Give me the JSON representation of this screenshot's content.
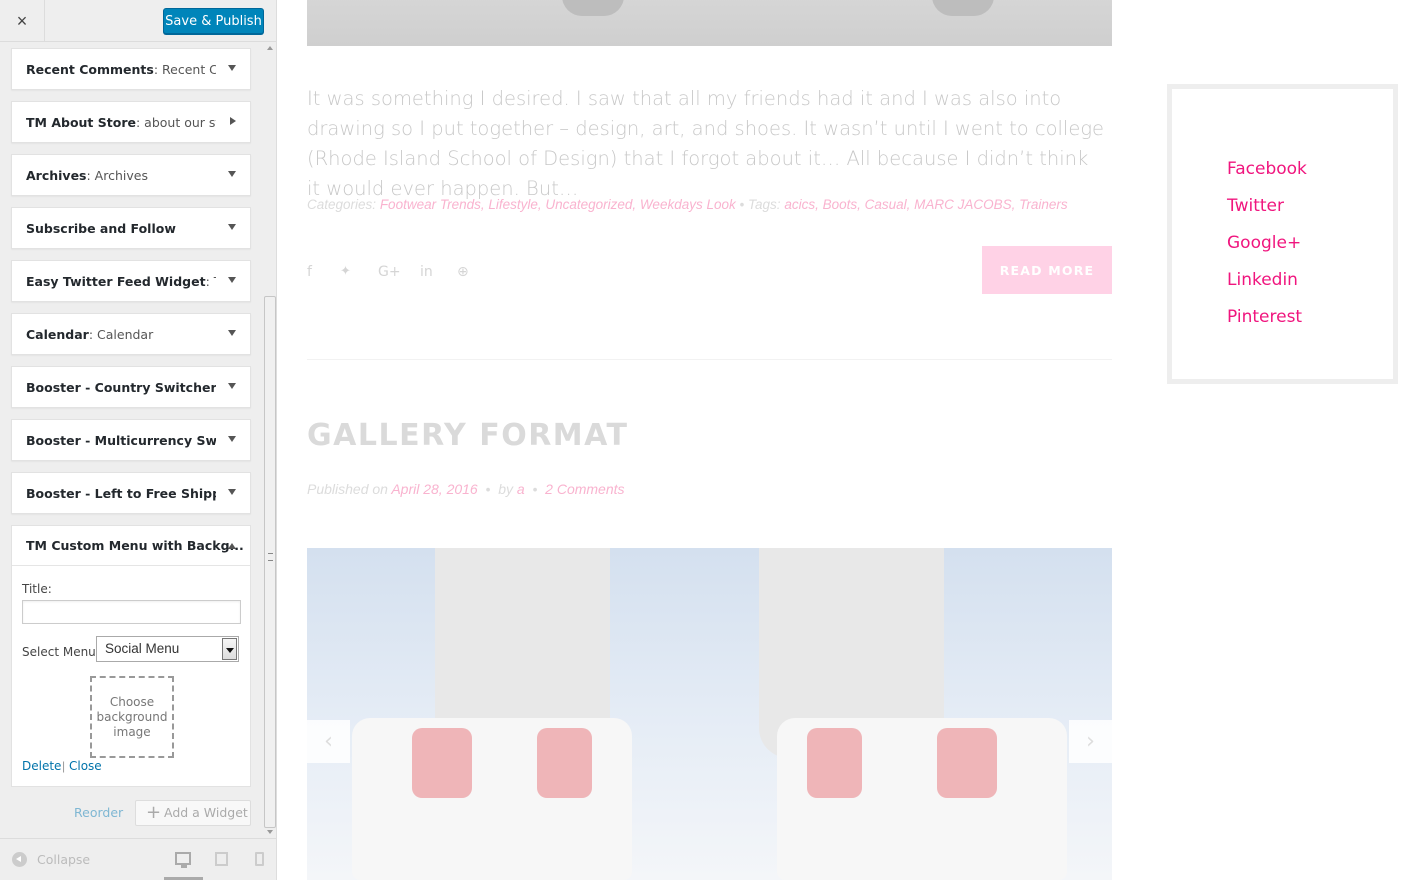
{
  "header": {
    "close_icon": "×",
    "save_label": "Save & Publish"
  },
  "widgets": [
    {
      "name": "Recent Comments",
      "subtitle": ": Recent Co...",
      "arrow": "down"
    },
    {
      "name": "TM About Store",
      "subtitle": ": about our st...",
      "arrow": "right"
    },
    {
      "name": "Archives",
      "subtitle": ": Archives",
      "arrow": "down"
    },
    {
      "name": "Subscribe and Follow",
      "subtitle": "",
      "arrow": "down"
    },
    {
      "name": "Easy Twitter Feed Widget",
      "subtitle": ": Twi...",
      "arrow": "down"
    },
    {
      "name": "Calendar",
      "subtitle": ": Calendar",
      "arrow": "down"
    },
    {
      "name": "Booster - Country Switcher",
      "subtitle": "",
      "arrow": "down"
    },
    {
      "name": "Booster - Multicurrency Switc...",
      "subtitle": "",
      "arrow": "down"
    },
    {
      "name": "Booster - Left to Free Shippin...",
      "subtitle": "",
      "arrow": "down"
    }
  ],
  "open_widget": {
    "name": "TM Custom Menu with Backg...",
    "title_label": "Title:",
    "title_value": "",
    "select_label": "Select Menu:",
    "select_value": "Social Menu",
    "bg_label": "Choose background image",
    "delete_label": "Delete",
    "separator": "|",
    "close_label": "Close"
  },
  "footer": {
    "reorder_label": "Reorder",
    "add_widget_label": "Add a Widget",
    "collapse_label": "Collapse"
  },
  "preview": {
    "excerpt": "It was something I desired. I saw that all my friends had it and I was also into drawing so I put together – design, art, and shoes. It wasn’t until I went to college (Rhode Island School of Design) that I forgot about it… All because I didn’t think it would ever happen. But…",
    "categories_label": "Categories:",
    "categories": "Footwear Trends, Lifestyle, Uncategorized, Weekdays Look",
    "meta_sep": "•",
    "tags_label": "Tags:",
    "tags": "acics, Boots, Casual, MARC JACOBS, Trainers",
    "share_icons": [
      {
        "name": "facebook-icon",
        "glyph": "f"
      },
      {
        "name": "twitter-icon",
        "glyph": "🐦"
      },
      {
        "name": "google-plus-icon",
        "glyph": "G+"
      },
      {
        "name": "linkedin-icon",
        "glyph": "in"
      },
      {
        "name": "pinterest-icon",
        "glyph": "℗"
      }
    ],
    "read_more": "READ MORE",
    "post_title": "GALLERY FORMAT",
    "published_prefix": "Published on",
    "published_date": "April 28, 2016",
    "by_label": "by",
    "author": "a",
    "comments": "2 Comments",
    "gallery_prev": "‹",
    "gallery_next": "›"
  },
  "social_menu": [
    "Facebook",
    "Twitter",
    "Google+",
    "Linkedin",
    "Pinterest"
  ],
  "colors": {
    "accent_pink": "#f0157e",
    "publish_blue": "#0085ba"
  }
}
